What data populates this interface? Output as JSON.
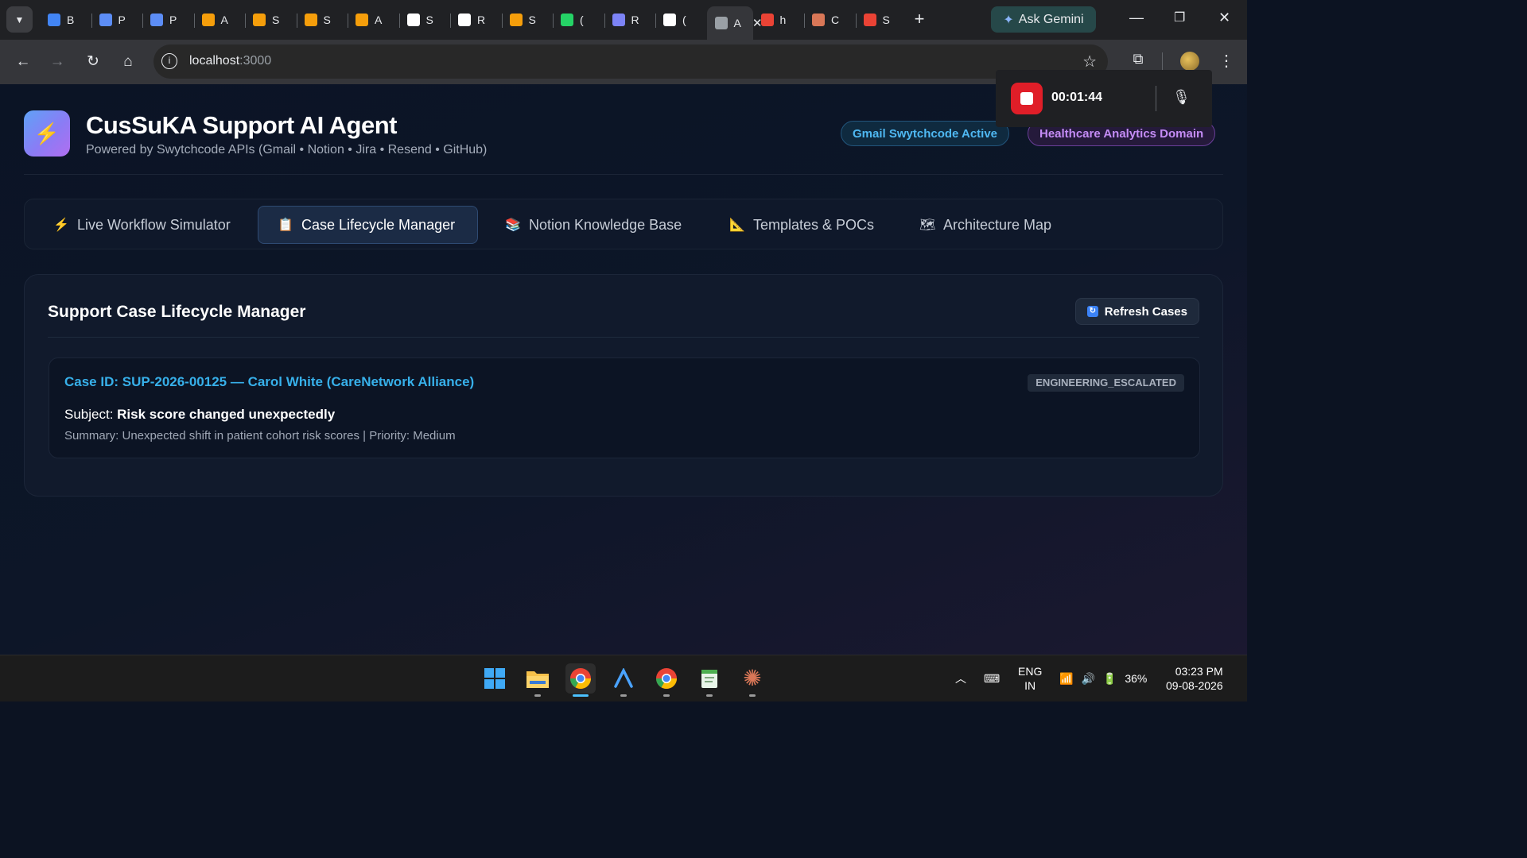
{
  "browser": {
    "tabs": [
      {
        "letter": "B",
        "icon": "google-docs-icon",
        "color": "#4285f4"
      },
      {
        "letter": "P",
        "icon": "bar-chart-icon",
        "color": "#5c8df6"
      },
      {
        "letter": "P",
        "icon": "bar-chart-icon",
        "color": "#5c8df6"
      },
      {
        "letter": "A",
        "icon": "bolt-icon",
        "color": "#f59e0b"
      },
      {
        "letter": "S",
        "icon": "bolt-icon",
        "color": "#f59e0b"
      },
      {
        "letter": "S",
        "icon": "bolt-icon",
        "color": "#f59e0b"
      },
      {
        "letter": "A",
        "icon": "bolt-icon",
        "color": "#f59e0b"
      },
      {
        "letter": "S",
        "icon": "github-icon",
        "color": "#ffffff"
      },
      {
        "letter": "R",
        "icon": "github-icon",
        "color": "#ffffff"
      },
      {
        "letter": "S",
        "icon": "bolt-icon",
        "color": "#f59e0b"
      },
      {
        "letter": "(",
        "icon": "whatsapp-icon",
        "color": "#25d366"
      },
      {
        "letter": "R",
        "icon": "grid-icon",
        "color": "#7c83f6"
      },
      {
        "letter": "(",
        "icon": "notion-icon",
        "color": "#ffffff"
      },
      {
        "letter": "A",
        "icon": "app-icon",
        "color": "#9aa0a6",
        "active": true
      },
      {
        "letter": "h",
        "icon": "google-icon",
        "color": "#ea4335"
      },
      {
        "letter": "C",
        "icon": "claude-icon",
        "color": "#d97757"
      },
      {
        "letter": "S",
        "icon": "google-icon",
        "color": "#ea4335"
      }
    ],
    "ask_gemini": "Ask Gemini",
    "url_host": "localhost",
    "url_port": ":3000"
  },
  "recorder": {
    "time": "00:01:44"
  },
  "header": {
    "title": "CusSuKA Support AI Agent",
    "subtitle": "Powered by Swytchcode APIs (Gmail • Notion • Jira • Resend • GitHub)",
    "badge_gmail": "Gmail Swytchcode Active",
    "badge_domain": "Healthcare Analytics Domain"
  },
  "nav": {
    "tabs": [
      {
        "label": "Live Workflow Simulator",
        "icon": "⚡"
      },
      {
        "label": "Case Lifecycle Manager",
        "icon": "📋"
      },
      {
        "label": "Notion Knowledge Base",
        "icon": "📚"
      },
      {
        "label": "Templates & POCs",
        "icon": "📐"
      },
      {
        "label": "Architecture Map",
        "icon": "🗺"
      }
    ]
  },
  "case_manager": {
    "title": "Support Case Lifecycle Manager",
    "refresh_label": "Refresh Cases",
    "cases": [
      {
        "id_line": "Case ID: SUP-2026-00125 — Carol White (CareNetwork Alliance)",
        "status": "ENGINEERING_ESCALATED",
        "subject_prefix": "Subject: ",
        "subject": "Risk score changed unexpectedly",
        "summary": "Summary: Unexpected shift in patient cohort risk scores | Priority: Medium"
      }
    ]
  },
  "taskbar": {
    "lang_top": "ENG",
    "lang_bottom": "IN",
    "battery": "36%",
    "time": "03:23 PM",
    "date": "09-08-2026"
  }
}
